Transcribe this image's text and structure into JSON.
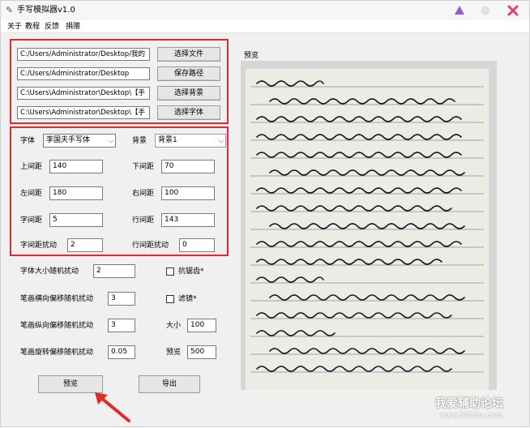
{
  "window": {
    "title": "手写模拟器v1.0"
  },
  "menu": [
    "关于",
    "教程",
    "反馈",
    "捐赠"
  ],
  "files": [
    {
      "path": "C:/Users/Administrator/Desktop/我的",
      "button": "选择文件"
    },
    {
      "path": "C:/Users/Administrator/Desktop",
      "button": "保存路径"
    },
    {
      "path": "C:\\Users\\Administrator\\Desktop\\【手",
      "button": "选择背景"
    },
    {
      "path": "C:\\Users\\Administrator\\Desktop\\【手",
      "button": "选择字体"
    }
  ],
  "font": {
    "label": "字体",
    "value": "李国夫手写体"
  },
  "background": {
    "label": "背景",
    "value": "背景1"
  },
  "params": {
    "top_margin": {
      "label": "上间距",
      "value": "140"
    },
    "bottom_margin": {
      "label": "下间距",
      "value": "70"
    },
    "left_margin": {
      "label": "左间距",
      "value": "180"
    },
    "right_margin": {
      "label": "右间距",
      "value": "100"
    },
    "char_spacing": {
      "label": "字间距",
      "value": "5"
    },
    "line_spacing": {
      "label": "行间距",
      "value": "143"
    },
    "char_spacing_jitter": {
      "label": "字间距扰动",
      "value": "2"
    },
    "line_spacing_jitter": {
      "label": "行间距扰动",
      "value": "0"
    }
  },
  "extra": {
    "font_size_jitter": {
      "label": "字体大小随机扰动",
      "value": "2"
    },
    "antialias": {
      "label": "抗锯齿*"
    },
    "h_offset_jitter": {
      "label": "笔画横向偏移随机扰动",
      "value": "3"
    },
    "filter": {
      "label": "滤镜*"
    },
    "v_offset_jitter": {
      "label": "笔画纵向偏移随机扰动",
      "value": "3"
    },
    "size": {
      "label": "大小",
      "value": "100"
    },
    "rotate_jitter": {
      "label": "笔画旋转偏移随机扰动",
      "value": "0.05"
    },
    "preview_size": {
      "label": "预览",
      "value": "500"
    }
  },
  "actions": {
    "preview": "预览",
    "export": "导出"
  },
  "preview_panel": {
    "label": "预览"
  },
  "watermark": {
    "line1": "我爱辅助论坛",
    "line2": "www.52fzba.com"
  },
  "colors": {
    "highlight": "#e02b2b",
    "minimize": "#9b59d6",
    "close": "#e0407a"
  }
}
